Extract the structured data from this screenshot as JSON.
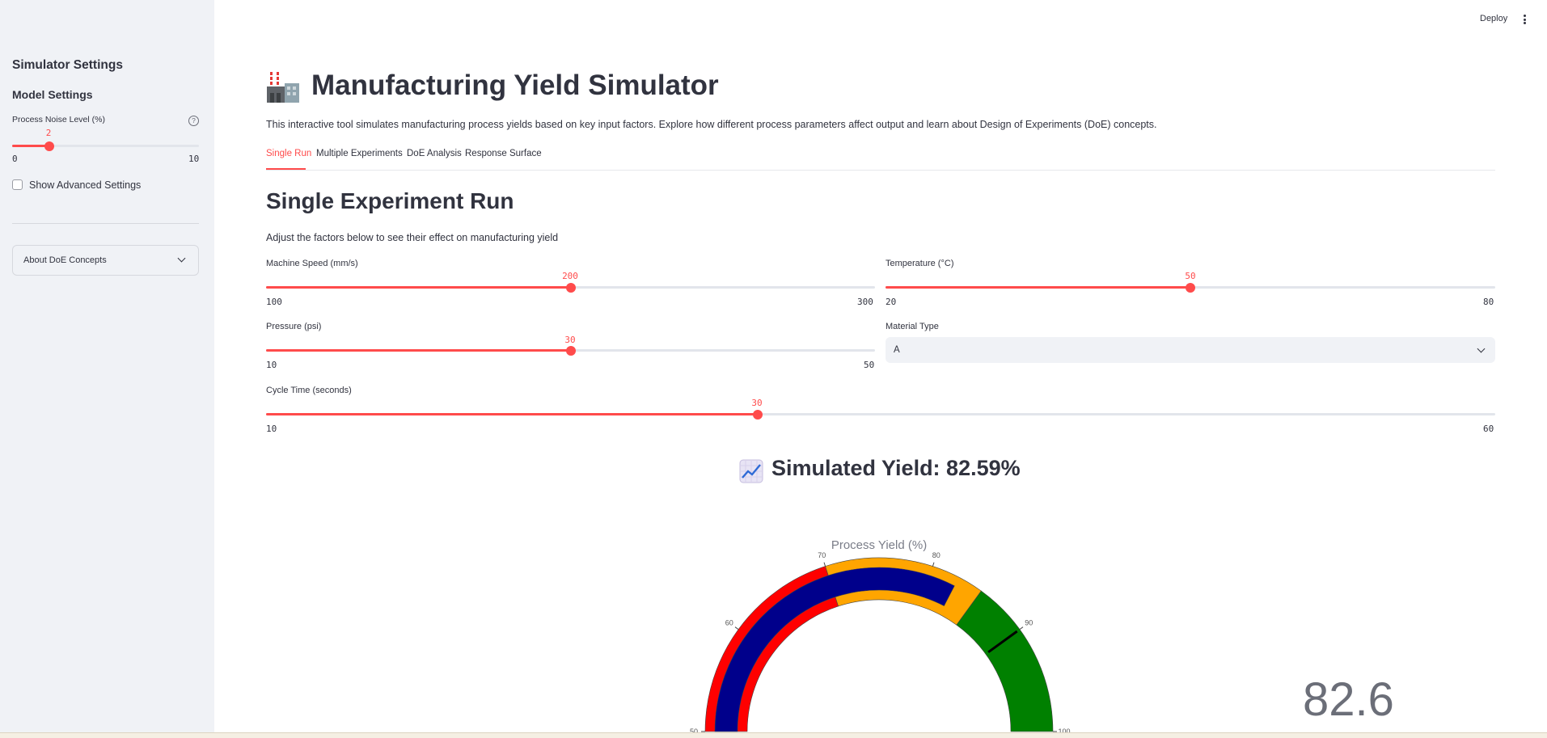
{
  "header": {
    "deploy_label": "Deploy"
  },
  "sidebar": {
    "title": "Simulator Settings",
    "model_settings": "Model Settings",
    "noise": {
      "label": "Process Noise Level (%)",
      "value": "2",
      "min": "0",
      "max": "10",
      "fraction": 0.2
    },
    "advanced_label": "Show Advanced Settings",
    "expander_label": "About DoE Concepts"
  },
  "main": {
    "title": "Manufacturing Yield Simulator",
    "intro": "This interactive tool simulates manufacturing process yields based on key input factors. Explore how different process parameters affect output and learn about Design of Experiments (DoE) concepts.",
    "tabs": [
      {
        "label": "Single Run"
      },
      {
        "label": "Multiple Experiments"
      },
      {
        "label": "DoE Analysis"
      },
      {
        "label": "Response Surface"
      }
    ],
    "section_title": "Single Experiment Run",
    "section_note": "Adjust the factors below to see their effect on manufacturing yield",
    "machine_speed": {
      "label": "Machine Speed (mm/s)",
      "value": "200",
      "min": "100",
      "max": "300",
      "fraction": 0.5
    },
    "temperature": {
      "label": "Temperature (°C)",
      "value": "50",
      "min": "20",
      "max": "80",
      "fraction": 0.5
    },
    "pressure": {
      "label": "Pressure (psi)",
      "value": "30",
      "min": "10",
      "max": "50",
      "fraction": 0.5
    },
    "material": {
      "label": "Material Type",
      "value": "A"
    },
    "cycle_time": {
      "label": "Cycle Time (seconds)",
      "value": "30",
      "min": "10",
      "max": "60",
      "fraction": 0.4
    },
    "yield_text": "Simulated Yield: 82.59%"
  },
  "gauge": {
    "title": "Process Yield (%)",
    "value": 82.6,
    "value_text": "82.6",
    "threshold": 90,
    "bands": [
      {
        "from": 50,
        "to": 70,
        "color": "#ff0000"
      },
      {
        "from": 70,
        "to": 85,
        "color": "#ffa500"
      },
      {
        "from": 85,
        "to": 100,
        "color": "#008000"
      }
    ],
    "bar_color": "#00008b",
    "ticks": [
      "50",
      "60",
      "70",
      "80",
      "90",
      "100"
    ]
  }
}
